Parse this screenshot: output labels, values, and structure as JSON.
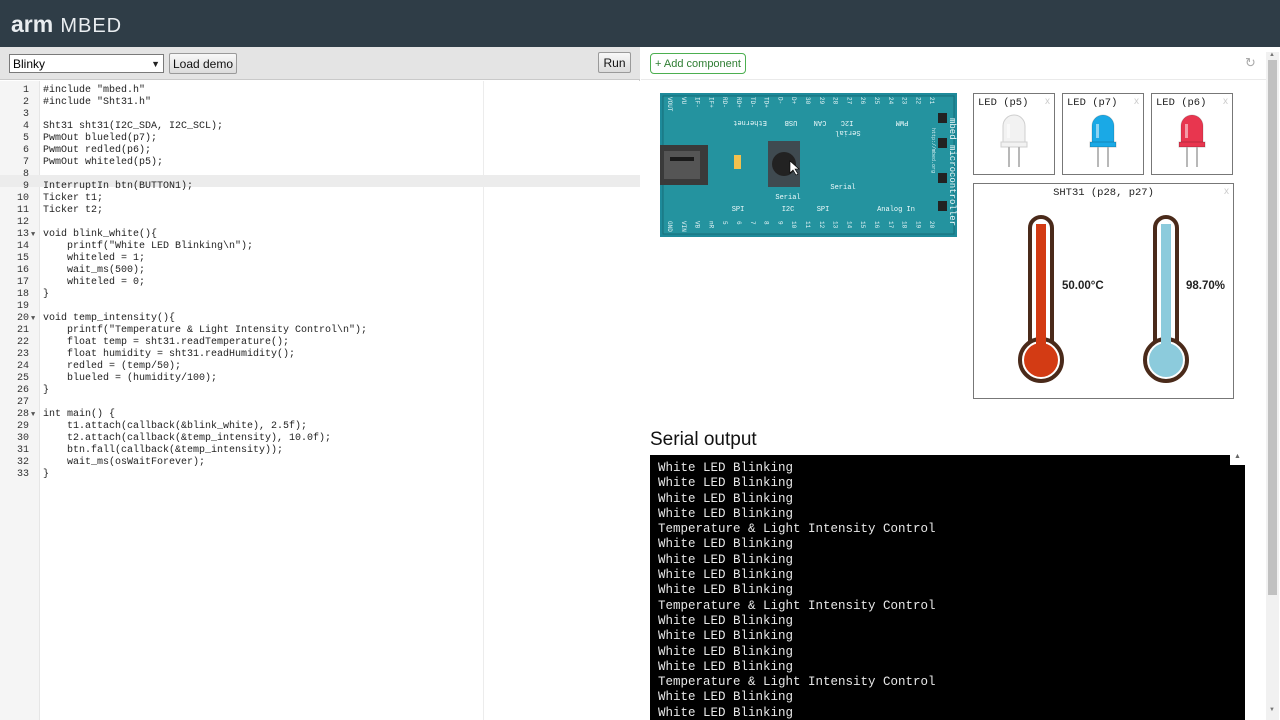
{
  "header": {
    "logo_arm": "arm",
    "logo_mbed": "MBED"
  },
  "toolbar": {
    "demo_selected": "Blinky",
    "load_label": "Load demo",
    "run_label": "Run"
  },
  "editor": {
    "lines": [
      {
        "n": "1",
        "code": "#include \"mbed.h\"",
        "fold": ""
      },
      {
        "n": "2",
        "code": "#include \"Sht31.h\"",
        "fold": ""
      },
      {
        "n": "3",
        "code": "",
        "fold": ""
      },
      {
        "n": "4",
        "code": "Sht31 sht31(I2C_SDA, I2C_SCL);",
        "fold": ""
      },
      {
        "n": "5",
        "code": "PwmOut blueled(p7);",
        "fold": ""
      },
      {
        "n": "6",
        "code": "PwmOut redled(p6);",
        "fold": ""
      },
      {
        "n": "7",
        "code": "PwmOut whiteled(p5);",
        "fold": ""
      },
      {
        "n": "8",
        "code": "",
        "fold": ""
      },
      {
        "n": "9",
        "code": "InterruptIn btn(BUTTON1);",
        "fold": ""
      },
      {
        "n": "10",
        "code": "Ticker t1;",
        "fold": ""
      },
      {
        "n": "11",
        "code": "Ticker t2;",
        "fold": ""
      },
      {
        "n": "12",
        "code": "",
        "fold": ""
      },
      {
        "n": "13",
        "code": "void blink_white(){",
        "fold": "▼"
      },
      {
        "n": "14",
        "code": "    printf(\"White LED Blinking\\n\");",
        "fold": ""
      },
      {
        "n": "15",
        "code": "    whiteled = 1;",
        "fold": ""
      },
      {
        "n": "16",
        "code": "    wait_ms(500);",
        "fold": ""
      },
      {
        "n": "17",
        "code": "    whiteled = 0;",
        "fold": ""
      },
      {
        "n": "18",
        "code": "}",
        "fold": ""
      },
      {
        "n": "19",
        "code": "",
        "fold": ""
      },
      {
        "n": "20",
        "code": "void temp_intensity(){",
        "fold": "▼"
      },
      {
        "n": "21",
        "code": "    printf(\"Temperature & Light Intensity Control\\n\");",
        "fold": ""
      },
      {
        "n": "22",
        "code": "    float temp = sht31.readTemperature();",
        "fold": ""
      },
      {
        "n": "23",
        "code": "    float humidity = sht31.readHumidity();",
        "fold": ""
      },
      {
        "n": "24",
        "code": "    redled = (temp/50);",
        "fold": ""
      },
      {
        "n": "25",
        "code": "    blueled = (humidity/100);",
        "fold": ""
      },
      {
        "n": "26",
        "code": "}",
        "fold": ""
      },
      {
        "n": "27",
        "code": "",
        "fold": ""
      },
      {
        "n": "28",
        "code": "int main() {",
        "fold": "▼"
      },
      {
        "n": "29",
        "code": "    t1.attach(callback(&blink_white), 2.5f);",
        "fold": ""
      },
      {
        "n": "30",
        "code": "    t2.attach(callback(&temp_intensity), 10.0f);",
        "fold": ""
      },
      {
        "n": "31",
        "code": "    btn.fall(callback(&temp_intensity));",
        "fold": ""
      },
      {
        "n": "32",
        "code": "    wait_ms(osWaitForever);",
        "fold": ""
      },
      {
        "n": "33",
        "code": "}",
        "fold": ""
      }
    ]
  },
  "sim": {
    "add_component_label": "+ Add component",
    "refresh_icon": "refresh-icon",
    "board": {
      "top_pins": [
        "VOUT",
        "VU",
        "IF-",
        "IF+",
        "RD-",
        "RD+",
        "TD-",
        "TD+",
        "D-",
        "D+",
        "30",
        "29",
        "28",
        "27",
        "26",
        "25",
        "24",
        "23",
        "22",
        "21"
      ],
      "bottom_pins": [
        "GND",
        "VIN",
        "VB",
        "nR",
        "5",
        "6",
        "7",
        "8",
        "9",
        "10",
        "11",
        "12",
        "13",
        "14",
        "15",
        "16",
        "17",
        "18",
        "19",
        "20"
      ],
      "labels_upper": [
        "Ethernet",
        "USB",
        "CAN",
        "I2C",
        "PWM"
      ],
      "label_serial_top": "Serial",
      "labels_lower": [
        "SPI",
        "Serial",
        "I2C",
        "SPI",
        "Analog In"
      ],
      "label_serial_mid": "Serial",
      "side_text": "mbed microcontroller",
      "url_text": "http://mbed.org"
    },
    "leds": [
      {
        "title": "LED (p5)",
        "color": "#f2f2f2"
      },
      {
        "title": "LED (p7)",
        "color": "#1aa9e6"
      },
      {
        "title": "LED (p6)",
        "color": "#e8364f"
      }
    ],
    "sht31": {
      "title": "SHT31 (p28, p27)",
      "temperature": "50.00°C",
      "humidity": "98.70%",
      "temp_color": "#d33b14",
      "hum_color": "#8ccbdc"
    },
    "close_glyph": "x"
  },
  "serial": {
    "title": "Serial output",
    "lines": [
      "White LED Blinking",
      "White LED Blinking",
      "White LED Blinking",
      "White LED Blinking",
      "Temperature & Light Intensity Control",
      "White LED Blinking",
      "White LED Blinking",
      "White LED Blinking",
      "White LED Blinking",
      "Temperature & Light Intensity Control",
      "White LED Blinking",
      "White LED Blinking",
      "White LED Blinking",
      "White LED Blinking",
      "Temperature & Light Intensity Control",
      "White LED Blinking",
      "White LED Blinking"
    ]
  }
}
